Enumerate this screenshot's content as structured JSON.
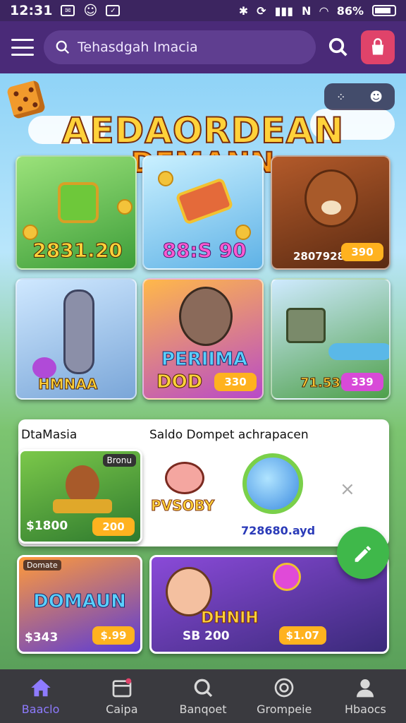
{
  "status": {
    "time": "12:31",
    "percent": "86%"
  },
  "search": {
    "placeholder": "Tehasdgah Imacia"
  },
  "hero": {
    "line1": "AEDAORDEAN",
    "line2": "DEMANN"
  },
  "cards": [
    {
      "label": "2831.20"
    },
    {
      "label": "88:S 90"
    },
    {
      "label": "2807928",
      "badge": "390"
    },
    {
      "label": "HMNAA"
    },
    {
      "title": "PERIIMA",
      "subtitle": "DOD",
      "badge": "330"
    },
    {
      "label": "71.530",
      "badge": "339"
    }
  ],
  "panel": {
    "left_title": "DtaMasia",
    "right_title": "Saldo Dompet achrapacen",
    "tile_tag": "Bronu",
    "tile_amount": "$1800",
    "tile_badge": "200",
    "promo_text": "PVSOBY",
    "balance": "728680.ayd",
    "close_label": "×"
  },
  "bottom_tiles": [
    {
      "tag": "Domate",
      "title": "DOMAUN",
      "amount": "$343",
      "badge": "$.99"
    },
    {
      "title": "DHNIH",
      "amount": "SB 200",
      "badge": "$1.07"
    }
  ],
  "nav": [
    {
      "label": "Baaclo",
      "icon": "home-icon"
    },
    {
      "label": "Caipa",
      "icon": "calendar-icon"
    },
    {
      "label": "Banqoet",
      "icon": "search-icon"
    },
    {
      "label": "Grompeie",
      "icon": "target-icon"
    },
    {
      "label": "Hbaocs",
      "icon": "profile-icon"
    }
  ],
  "colors": {
    "accent": "#8e7bff",
    "topbar": "#4a2a78",
    "fab": "#3fb84a",
    "gold": "#ffd23a"
  }
}
